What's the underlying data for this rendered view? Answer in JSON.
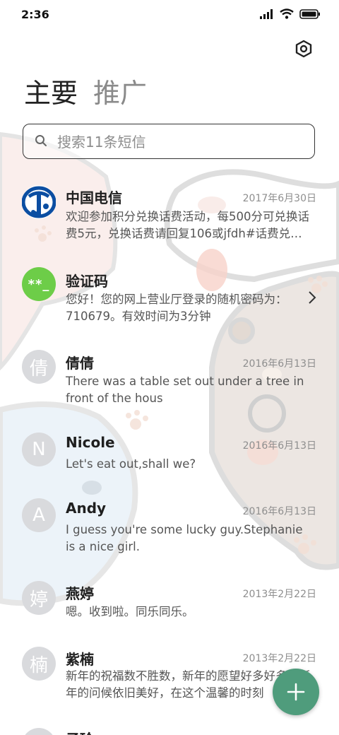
{
  "status_bar": {
    "time": "2:36"
  },
  "tabs": [
    {
      "label": "主要",
      "active": true
    },
    {
      "label": "推广",
      "active": false
    }
  ],
  "search": {
    "placeholder": "搜索11条短信"
  },
  "messages": [
    {
      "name": "中国电信",
      "date": "2017年6月30日",
      "preview": "欢迎参加积分兑换话费活动，每500分可兑换话费5元，兑换话费请回复106或jfdh#话费兑换分",
      "avatar_type": "logo",
      "avatar_icon": "china-telecom-logo"
    },
    {
      "name": "验证码",
      "date": "",
      "preview": "您好！您的网上营业厅登录的随机密码为：710679。有效时间为3分钟",
      "avatar_type": "code",
      "avatar_text": "**_"
    },
    {
      "name": "倩倩",
      "date": "2016年6月13日",
      "preview": "There was a table set out under a tree in front of the hous",
      "avatar_text": "倩"
    },
    {
      "name": "Nicole",
      "date": "2016年6月13日",
      "preview": "Let's eat out,shall we?",
      "avatar_text": "N"
    },
    {
      "name": "Andy",
      "date": "2016年6月13日",
      "preview": "I guess you're some lucky guy.Stephanie is a nice girl.",
      "avatar_text": "A"
    },
    {
      "name": "燕婷",
      "date": "2013年2月22日",
      "preview": "嗯。收到啦。同乐同乐。",
      "avatar_text": "婷"
    },
    {
      "name": "紫楠",
      "date": "2013年2月22日",
      "preview": "新年的祝福数不胜数，新年的愿望好多好多，新年的问候依旧美好，在这个温馨的时刻",
      "avatar_text": "楠"
    },
    {
      "name": "子玲",
      "date": "",
      "preview": "",
      "avatar_text": ""
    }
  ],
  "colors": {
    "fab": "#4f9c7c",
    "code_avatar": "#6dcd48",
    "telecom_blue": "#0b4ea2"
  }
}
